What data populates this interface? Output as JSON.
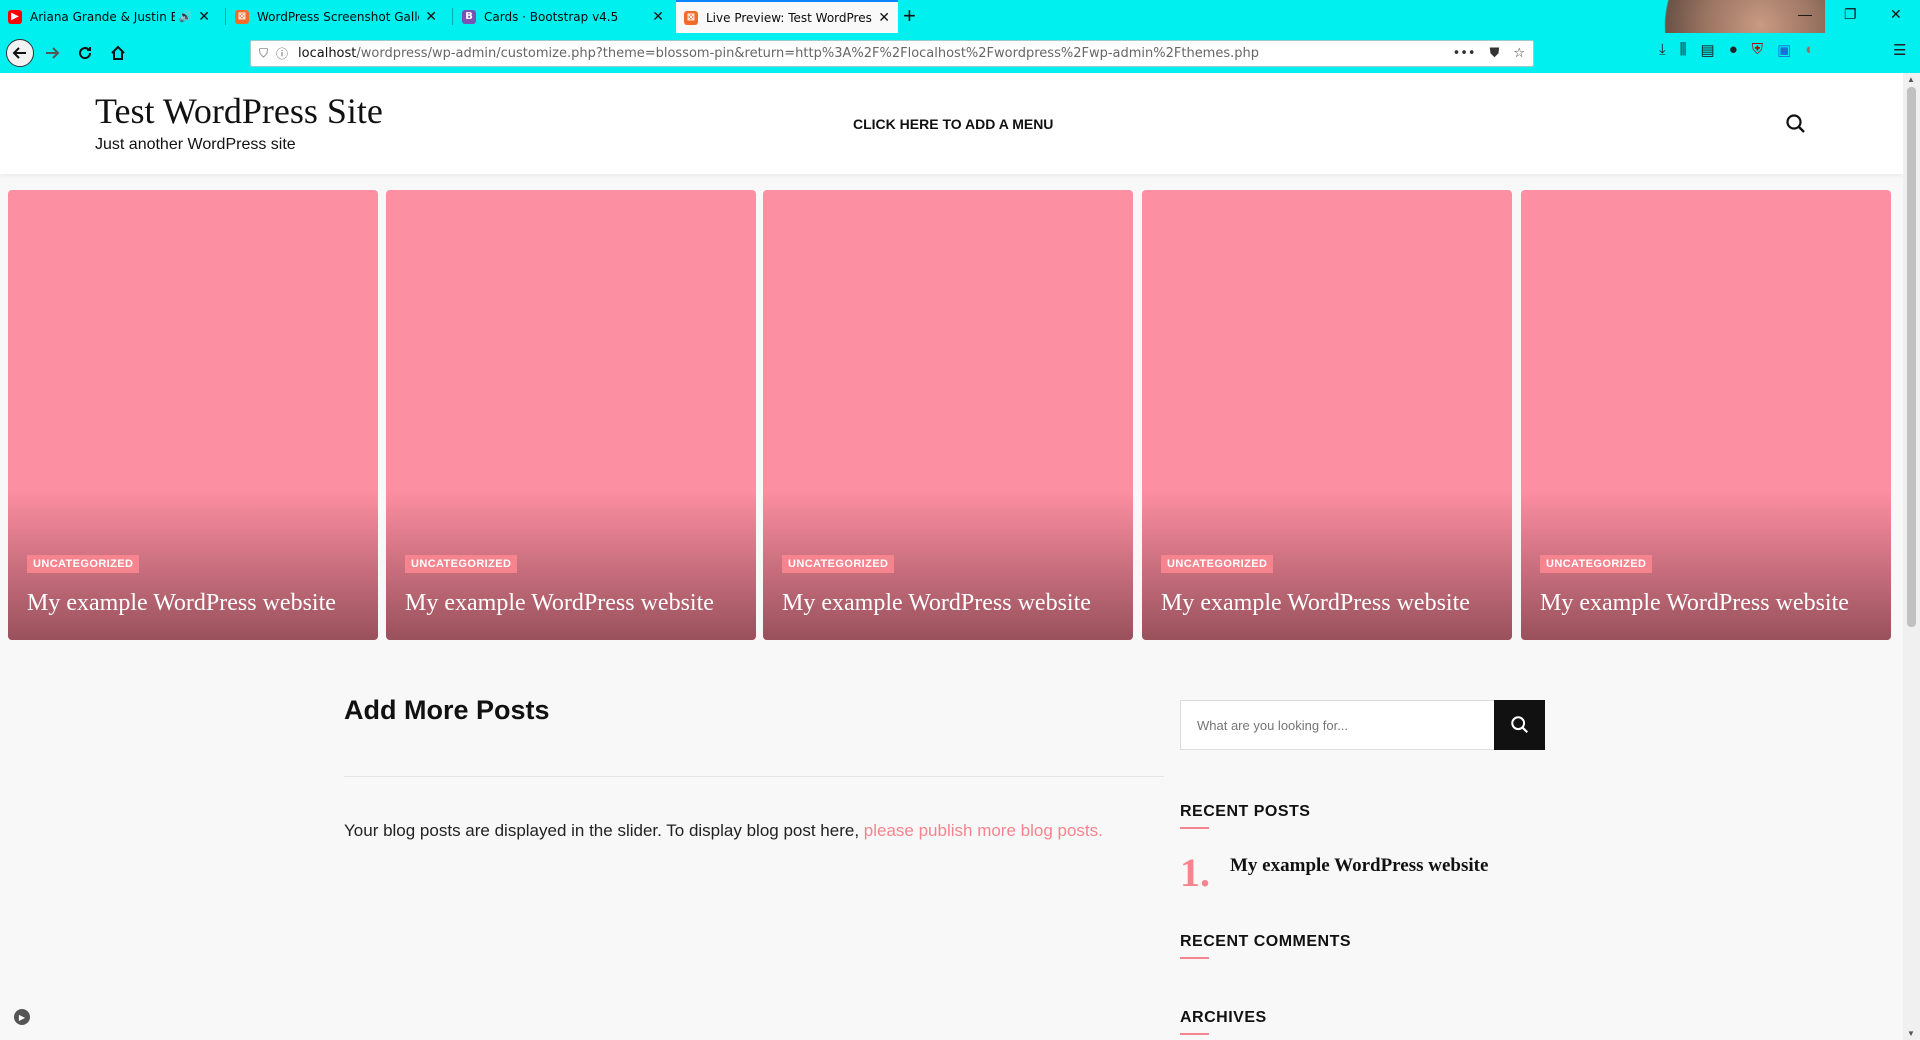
{
  "browser": {
    "tabs": [
      {
        "title": "Ariana Grande & Justin Bieb",
        "favicon_color": "#ff0000",
        "muted_icon": "speaker-icon"
      },
      {
        "title": "WordPress Screenshot Gallery",
        "favicon_color": "#f26b2b"
      },
      {
        "title": "Cards · Bootstrap v4.5",
        "favicon_color": "#7952b3",
        "favicon_letter": "B"
      },
      {
        "title": "Live Preview: Test WordPress S",
        "favicon_color": "#f26b2b",
        "active": true
      }
    ],
    "url": {
      "host": "localhost",
      "path": "/wordpress/wp-admin/customize.php?theme=blossom-pin&return=http%3A%2F%2Flocalhost%2Fwordpress%2Fwp-admin%2Fthemes.php"
    },
    "url_actions": [
      "more-icon",
      "pocket-icon",
      "bookmark-star-icon"
    ],
    "toolbar_icons": [
      "downloads-icon",
      "library-icon",
      "reader-icon",
      "account-icon",
      "ublock-icon",
      "extension-s-icon",
      "extension-icon",
      "menu-icon"
    ]
  },
  "site": {
    "title": "Test WordPress Site",
    "tagline": "Just another WordPress site",
    "menu_link": "CLICK HERE TO ADD A MENU"
  },
  "slider": {
    "cards": [
      {
        "category": "UNCATEGORIZED",
        "title": "My example WordPress website"
      },
      {
        "category": "UNCATEGORIZED",
        "title": "My example WordPress website"
      },
      {
        "category": "UNCATEGORIZED",
        "title": "My example WordPress website"
      },
      {
        "category": "UNCATEGORIZED",
        "title": "My example WordPress website"
      },
      {
        "category": "UNCATEGORIZED",
        "title": "My example WordPress website"
      }
    ]
  },
  "content": {
    "heading": "Add More Posts",
    "text": "Your blog posts are displayed in the slider. To display blog post here, ",
    "link_text": "please publish more blog posts."
  },
  "sidebar": {
    "search_placeholder": "What are you looking for...",
    "recent_posts_title": "RECENT POSTS",
    "recent_posts": [
      {
        "number": "1.",
        "title": "My example WordPress website"
      }
    ],
    "recent_comments_title": "RECENT COMMENTS",
    "archives_title": "ARCHIVES"
  },
  "colors": {
    "accent": "#f6848f",
    "card_bg": "#fd8fa2",
    "browser_chrome": "#00f0f0"
  }
}
